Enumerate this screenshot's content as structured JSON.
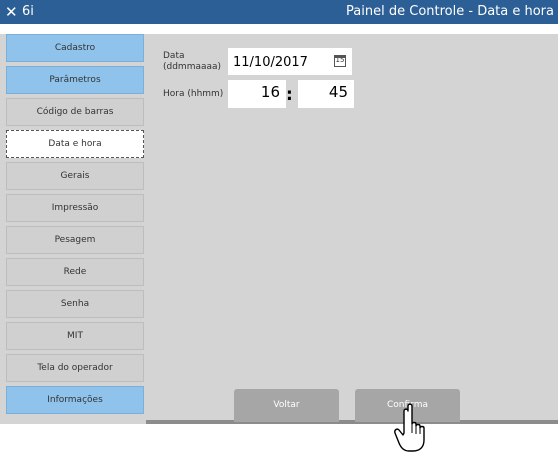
{
  "titlebar": {
    "close_glyph": "✕",
    "app_name": "6i",
    "title": "Painel de Controle - Data e hora"
  },
  "sidebar": {
    "items": [
      {
        "label": "Cadastro"
      },
      {
        "label": "Parâmetros"
      },
      {
        "label": "Código de barras"
      },
      {
        "label": "Data e hora"
      },
      {
        "label": "Gerais"
      },
      {
        "label": "Impressão"
      },
      {
        "label": "Pesagem"
      },
      {
        "label": "Rede"
      },
      {
        "label": "Senha"
      },
      {
        "label": "MIT"
      },
      {
        "label": "Tela do operador"
      },
      {
        "label": "Informações"
      }
    ],
    "active_item": "Data e hora"
  },
  "form": {
    "date_label_line1": "Data",
    "date_label_line2": "(ddmmaaaa)",
    "date_value": "11/10/2017",
    "calendar_icon_text": "15",
    "time_label": "Hora (hhmm)",
    "hour_value": "16",
    "separator": ":",
    "minute_value": "45"
  },
  "footer": {
    "back_label": "Voltar",
    "confirm_label": "Confirma"
  },
  "colors": {
    "titlebar": "#2c5f95",
    "nav_highlight": "#8fc3ec",
    "panel": "#d4d4d4",
    "button": "#a6a6a6"
  }
}
